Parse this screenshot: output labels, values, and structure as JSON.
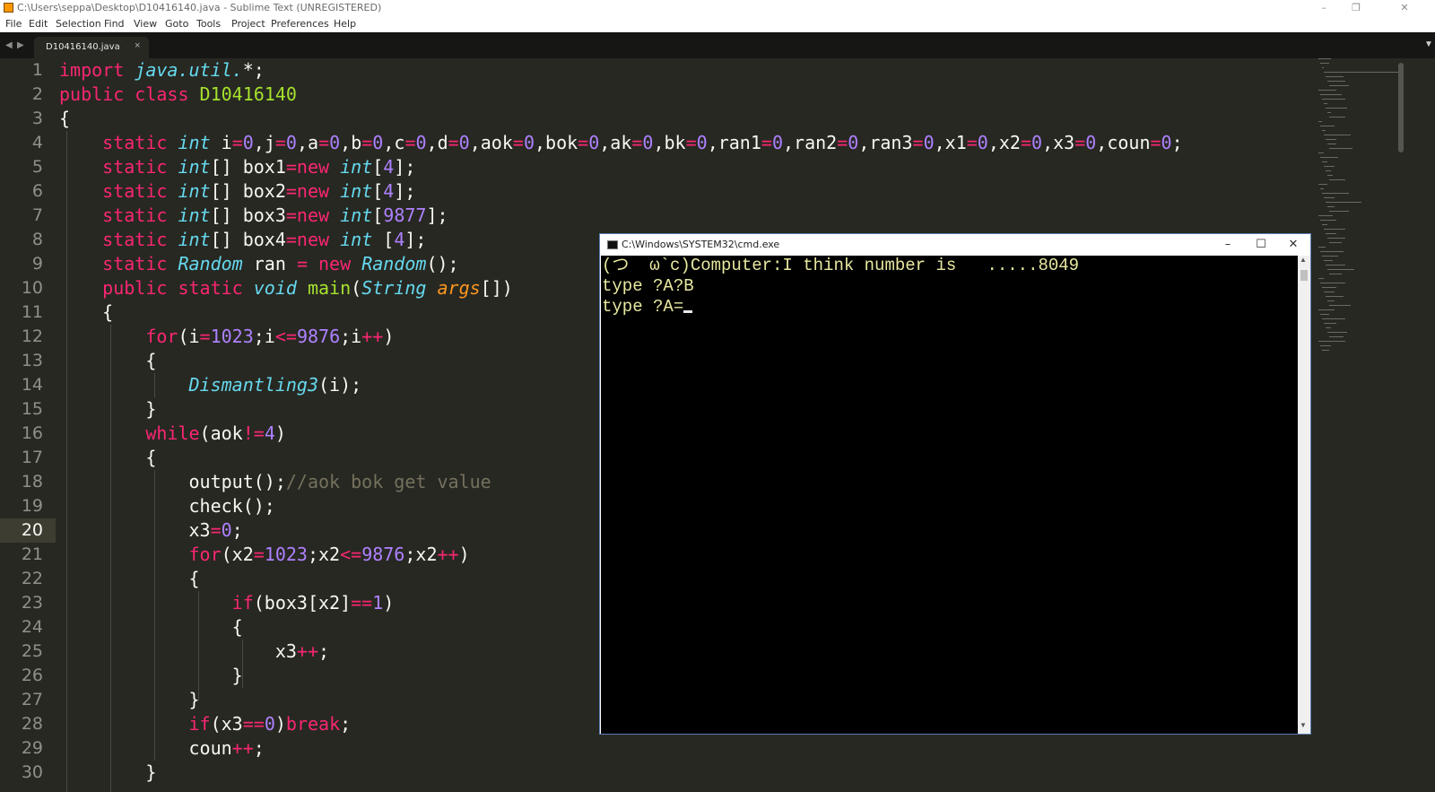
{
  "window": {
    "title": "C:\\Users\\seppa\\Desktop\\D10416140.java - Sublime Text (UNREGISTERED)",
    "controls": {
      "minimize": "–",
      "maximize": "❐",
      "close": "✕"
    }
  },
  "menu": [
    "File",
    "Edit",
    "Selection",
    "Find",
    "View",
    "Goto",
    "Tools",
    "Project",
    "Preferences",
    "Help"
  ],
  "tabs": [
    {
      "label": "D10416140.java",
      "close": "×"
    }
  ],
  "nav": {
    "back": "◀",
    "forward": "▶",
    "dropdown": "▼"
  },
  "editor": {
    "active_line": 20,
    "line_numbers": [
      "1",
      "2",
      "3",
      "4",
      "5",
      "6",
      "7",
      "8",
      "9",
      "10",
      "11",
      "12",
      "13",
      "14",
      "15",
      "16",
      "17",
      "18",
      "19",
      "20",
      "21",
      "22",
      "23",
      "24",
      "25",
      "26",
      "27",
      "28",
      "29",
      "30"
    ],
    "lines": [
      [
        [
          "kw",
          "import "
        ],
        [
          "st",
          "java.util."
        ],
        [
          "",
          "*;"
        ]
      ],
      [
        [
          "kw",
          "public class "
        ],
        [
          "cn",
          "D10416140"
        ]
      ],
      [
        [
          "",
          "{"
        ]
      ],
      [
        [
          "",
          "    "
        ],
        [
          "kw",
          "static "
        ],
        [
          "st",
          "int "
        ],
        [
          "",
          "i"
        ],
        [
          "kw",
          "="
        ],
        [
          "nu",
          "0"
        ],
        [
          "",
          ",j"
        ],
        [
          "kw",
          "="
        ],
        [
          "nu",
          "0"
        ],
        [
          "",
          ",a"
        ],
        [
          "kw",
          "="
        ],
        [
          "nu",
          "0"
        ],
        [
          "",
          ",b"
        ],
        [
          "kw",
          "="
        ],
        [
          "nu",
          "0"
        ],
        [
          "",
          ",c"
        ],
        [
          "kw",
          "="
        ],
        [
          "nu",
          "0"
        ],
        [
          "",
          ",d"
        ],
        [
          "kw",
          "="
        ],
        [
          "nu",
          "0"
        ],
        [
          "",
          ",aok"
        ],
        [
          "kw",
          "="
        ],
        [
          "nu",
          "0"
        ],
        [
          "",
          ",bok"
        ],
        [
          "kw",
          "="
        ],
        [
          "nu",
          "0"
        ],
        [
          "",
          ",ak"
        ],
        [
          "kw",
          "="
        ],
        [
          "nu",
          "0"
        ],
        [
          "",
          ",bk"
        ],
        [
          "kw",
          "="
        ],
        [
          "nu",
          "0"
        ],
        [
          "",
          ",ran1"
        ],
        [
          "kw",
          "="
        ],
        [
          "nu",
          "0"
        ],
        [
          "",
          ",ran2"
        ],
        [
          "kw",
          "="
        ],
        [
          "nu",
          "0"
        ],
        [
          "",
          ",ran3"
        ],
        [
          "kw",
          "="
        ],
        [
          "nu",
          "0"
        ],
        [
          "",
          ",x1"
        ],
        [
          "kw",
          "="
        ],
        [
          "nu",
          "0"
        ],
        [
          "",
          ",x2"
        ],
        [
          "kw",
          "="
        ],
        [
          "nu",
          "0"
        ],
        [
          "",
          ",x3"
        ],
        [
          "kw",
          "="
        ],
        [
          "nu",
          "0"
        ],
        [
          "",
          ",coun"
        ],
        [
          "kw",
          "="
        ],
        [
          "nu",
          "0"
        ],
        [
          "",
          ";"
        ]
      ],
      [
        [
          "",
          "    "
        ],
        [
          "kw",
          "static "
        ],
        [
          "st",
          "int"
        ],
        [
          "",
          "[] box1"
        ],
        [
          "kw",
          "=new "
        ],
        [
          "st",
          "int"
        ],
        [
          "",
          "["
        ],
        [
          "nu",
          "4"
        ],
        [
          "",
          "];"
        ]
      ],
      [
        [
          "",
          "    "
        ],
        [
          "kw",
          "static "
        ],
        [
          "st",
          "int"
        ],
        [
          "",
          "[] box2"
        ],
        [
          "kw",
          "=new "
        ],
        [
          "st",
          "int"
        ],
        [
          "",
          "["
        ],
        [
          "nu",
          "4"
        ],
        [
          "",
          "];"
        ]
      ],
      [
        [
          "",
          "    "
        ],
        [
          "kw",
          "static "
        ],
        [
          "st",
          "int"
        ],
        [
          "",
          "[] box3"
        ],
        [
          "kw",
          "=new "
        ],
        [
          "st",
          "int"
        ],
        [
          "",
          "["
        ],
        [
          "nu",
          "9877"
        ],
        [
          "",
          "];"
        ]
      ],
      [
        [
          "",
          "    "
        ],
        [
          "kw",
          "static "
        ],
        [
          "st",
          "int"
        ],
        [
          "",
          "[] box4"
        ],
        [
          "kw",
          "=new "
        ],
        [
          "st",
          "int "
        ],
        [
          "",
          "["
        ],
        [
          "nu",
          "4"
        ],
        [
          "",
          "];"
        ]
      ],
      [
        [
          "",
          "    "
        ],
        [
          "kw",
          "static "
        ],
        [
          "st",
          "Random "
        ],
        [
          "",
          "ran "
        ],
        [
          "kw",
          "= new "
        ],
        [
          "st",
          "Random"
        ],
        [
          "",
          "();"
        ]
      ],
      [
        [
          "",
          "    "
        ],
        [
          "kw",
          "public static "
        ],
        [
          "st",
          "void "
        ],
        [
          "cn",
          "main"
        ],
        [
          "",
          "("
        ],
        [
          "st",
          "String "
        ],
        [
          "ar",
          "args"
        ],
        [
          "",
          "[])"
        ]
      ],
      [
        [
          "",
          "    {"
        ]
      ],
      [
        [
          "",
          "        "
        ],
        [
          "kw",
          "for"
        ],
        [
          "",
          "(i"
        ],
        [
          "kw",
          "="
        ],
        [
          "nu",
          "1023"
        ],
        [
          "",
          ";i"
        ],
        [
          "kw",
          "<="
        ],
        [
          "nu",
          "9876"
        ],
        [
          "",
          ";i"
        ],
        [
          "kw",
          "++"
        ],
        [
          "",
          ")"
        ]
      ],
      [
        [
          "",
          "        {"
        ]
      ],
      [
        [
          "",
          "            "
        ],
        [
          "st",
          "Dismantling3"
        ],
        [
          "",
          "(i);"
        ]
      ],
      [
        [
          "",
          "        }"
        ]
      ],
      [
        [
          "",
          "        "
        ],
        [
          "kw",
          "while"
        ],
        [
          "",
          "(aok"
        ],
        [
          "kw",
          "!="
        ],
        [
          "nu",
          "4"
        ],
        [
          "",
          ")"
        ]
      ],
      [
        [
          "",
          "        {"
        ]
      ],
      [
        [
          "",
          "            output();"
        ],
        [
          "cm",
          "//aok bok get value"
        ]
      ],
      [
        [
          "",
          "            check();"
        ]
      ],
      [
        [
          "",
          "            x3"
        ],
        [
          "kw",
          "="
        ],
        [
          "nu",
          "0"
        ],
        [
          "",
          ";"
        ]
      ],
      [
        [
          "",
          "            "
        ],
        [
          "kw",
          "for"
        ],
        [
          "",
          "(x2"
        ],
        [
          "kw",
          "="
        ],
        [
          "nu",
          "1023"
        ],
        [
          "",
          ";x2"
        ],
        [
          "kw",
          "<="
        ],
        [
          "nu",
          "9876"
        ],
        [
          "",
          ";x2"
        ],
        [
          "kw",
          "++"
        ],
        [
          "",
          ")"
        ]
      ],
      [
        [
          "",
          "            {"
        ]
      ],
      [
        [
          "",
          "                "
        ],
        [
          "kw",
          "if"
        ],
        [
          "",
          "(box3[x2]"
        ],
        [
          "kw",
          "=="
        ],
        [
          "nu",
          "1"
        ],
        [
          "",
          ")"
        ]
      ],
      [
        [
          "",
          "                {"
        ]
      ],
      [
        [
          "",
          "                    x3"
        ],
        [
          "kw",
          "++"
        ],
        [
          "",
          ";"
        ]
      ],
      [
        [
          "",
          "                }"
        ]
      ],
      [
        [
          "",
          "            }"
        ]
      ],
      [
        [
          "",
          "            "
        ],
        [
          "kw",
          "if"
        ],
        [
          "",
          "(x3"
        ],
        [
          "kw",
          "=="
        ],
        [
          "nu",
          "0"
        ],
        [
          "",
          ")"
        ],
        [
          "kw",
          "break"
        ],
        [
          "",
          ";"
        ]
      ],
      [
        [
          "",
          "            coun"
        ],
        [
          "kw",
          "++"
        ],
        [
          "",
          ";"
        ]
      ],
      [
        [
          "",
          "        }"
        ]
      ]
    ]
  },
  "cmd": {
    "title": "C:\\Windows\\SYSTEM32\\cmd.exe",
    "controls": {
      "minimize": "–",
      "maximize": "☐",
      "close": "✕"
    },
    "lines": [
      "(つ  ω`c)Computer:I think number is   .....8049",
      "type ?A?B",
      "type ?A="
    ]
  },
  "colors": {
    "background": "#272822",
    "keyword": "#f92672",
    "storage": "#66d9ef",
    "number": "#ae81ff",
    "class": "#a6e22e",
    "argument": "#fd971f",
    "comment": "#75715e",
    "console_text": "#e8e8a0"
  }
}
